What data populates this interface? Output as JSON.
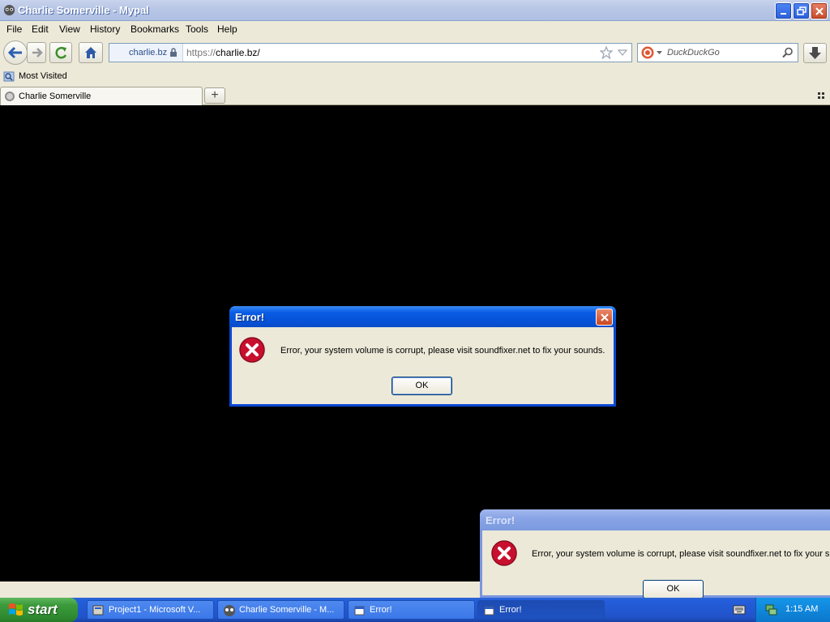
{
  "window": {
    "title": "Charlie Somerville - Mypal"
  },
  "menubar": {
    "items": [
      "File",
      "Edit",
      "View",
      "History",
      "Bookmarks",
      "Tools",
      "Help"
    ]
  },
  "navbar": {
    "identity_label": "charlie.bz",
    "url_scheme": "https://",
    "url_host": "charlie.bz/",
    "search_placeholder": "DuckDuckGo"
  },
  "bookmarks": {
    "item": "Most Visited"
  },
  "tabs": [
    {
      "label": "Charlie Somerville"
    }
  ],
  "dialogs": [
    {
      "title": "Error!",
      "message": "Error, your system volume is corrupt, please visit soundfixer.net to fix your sounds.",
      "ok_label": "OK"
    },
    {
      "title": "Error!",
      "message": "Error, your system volume is corrupt, please visit soundfixer.net to fix your s",
      "ok_label": "OK"
    }
  ],
  "taskbar": {
    "start_label": "start",
    "tasks": [
      {
        "label": "Project1 - Microsoft V..."
      },
      {
        "label": "Charlie Somerville - M..."
      },
      {
        "label": "Error!"
      },
      {
        "label": "Error!"
      }
    ],
    "clock": "1:15 AM"
  },
  "colors": {
    "xp_blue": "#0a47d6",
    "error_red": "#c8102e",
    "start_green": "#3c9a3c"
  }
}
